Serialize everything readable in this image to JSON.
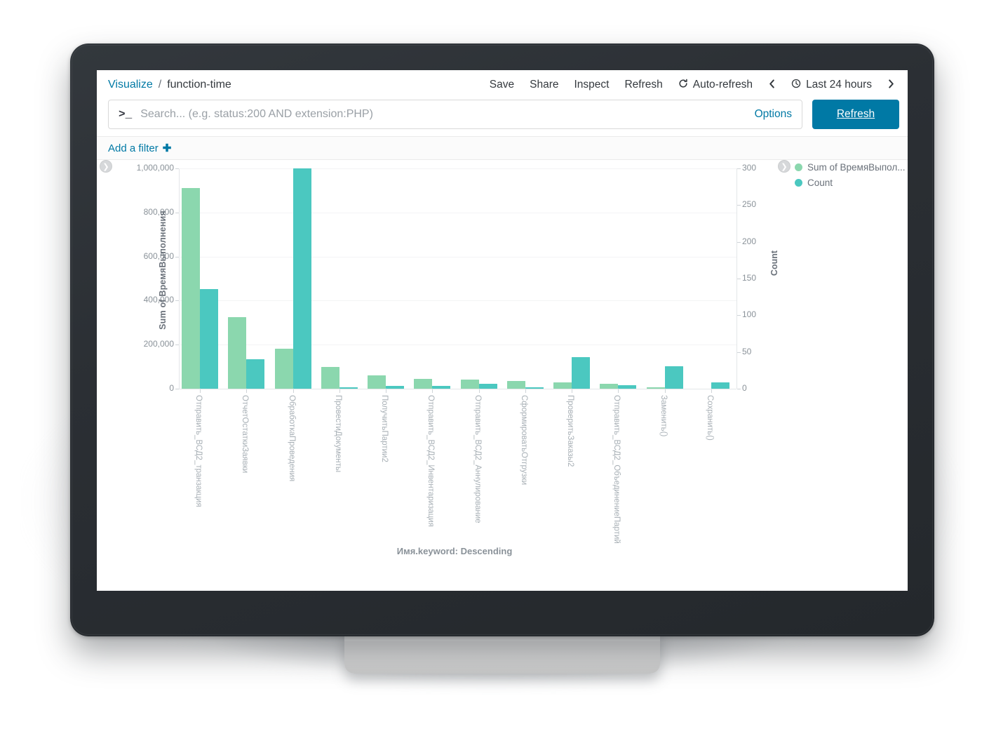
{
  "breadcrumb": {
    "root": "Visualize",
    "separator": "/",
    "current": "function-time"
  },
  "toolbar": {
    "save": "Save",
    "share": "Share",
    "inspect": "Inspect",
    "refresh": "Refresh",
    "auto_refresh": "Auto-refresh",
    "auto_refresh_icon": "refresh-cycle-icon",
    "prev_icon": "chevron-left-icon",
    "next_icon": "chevron-right-icon",
    "clock_icon": "clock-icon",
    "time_range": "Last 24 hours"
  },
  "query": {
    "prompt_glyph": ">_",
    "placeholder": "Search... (e.g. status:200 AND extension:PHP)",
    "value": "",
    "options_label": "Options",
    "refresh_label": "Refresh"
  },
  "filters": {
    "add_label": "Add a filter",
    "add_icon": "plus-icon"
  },
  "panel": {
    "collapse_left_icon": "chevron-right-circle-icon",
    "collapse_right_icon": "chevron-right-circle-icon"
  },
  "colors": {
    "series_green": "#8BD7AE",
    "series_teal": "#4BC8C0",
    "accent_blue": "#0079A5",
    "link_blue": "#0079A5",
    "bezel_dark": "#2B2F34",
    "axis_text": "#8A9299",
    "xlabel_text": "#A8B0B6"
  },
  "chart_data": {
    "type": "bar",
    "title": "",
    "xlabel": "Имя.keyword: Descending",
    "ylabel": "Sum of ВремяВыполнения",
    "ylabel_right": "Count",
    "grid": true,
    "legend_position": "right",
    "ylim": [
      0,
      1000000
    ],
    "ylim_right": [
      0,
      300
    ],
    "yticks": [
      "0",
      "200,000",
      "400,000",
      "600,000",
      "800,000",
      "1,000,000"
    ],
    "ytick_values": [
      0,
      200000,
      400000,
      600000,
      800000,
      1000000
    ],
    "yticks_right": [
      "0",
      "50",
      "100",
      "150",
      "200",
      "250",
      "300"
    ],
    "ytick_values_right": [
      0,
      50,
      100,
      150,
      200,
      250,
      300
    ],
    "categories": [
      "Отправить_ВСД2_транзакция",
      "ОтчетОстаткиЗаявки",
      "ОбработкаПроведения",
      "ПровестиДокументы",
      "ПолучитьПартии2",
      "Отправить_ВСД2_Инвентаризация",
      "Отправить_ВСД2_Аннулирование",
      "СформироватьОтгрузки",
      "ПроверитьЗаказы2",
      "Отправить_ВСД2_ОбъединениеПартий",
      "Заменить()",
      "Сохранить()"
    ],
    "series": [
      {
        "name": "Sum of ВремяВыпол...",
        "full_name": "Sum of ВремяВыполнения",
        "axis": "left",
        "color": "#8BD7AE",
        "values": [
          910000,
          325000,
          180000,
          98000,
          62000,
          46000,
          40000,
          35000,
          28000,
          23000,
          5000,
          0
        ]
      },
      {
        "name": "Count",
        "axis": "right",
        "color": "#4BC8C0",
        "values": [
          136,
          40,
          300,
          2,
          4,
          4,
          7,
          2,
          43,
          5,
          31,
          9
        ]
      }
    ]
  }
}
